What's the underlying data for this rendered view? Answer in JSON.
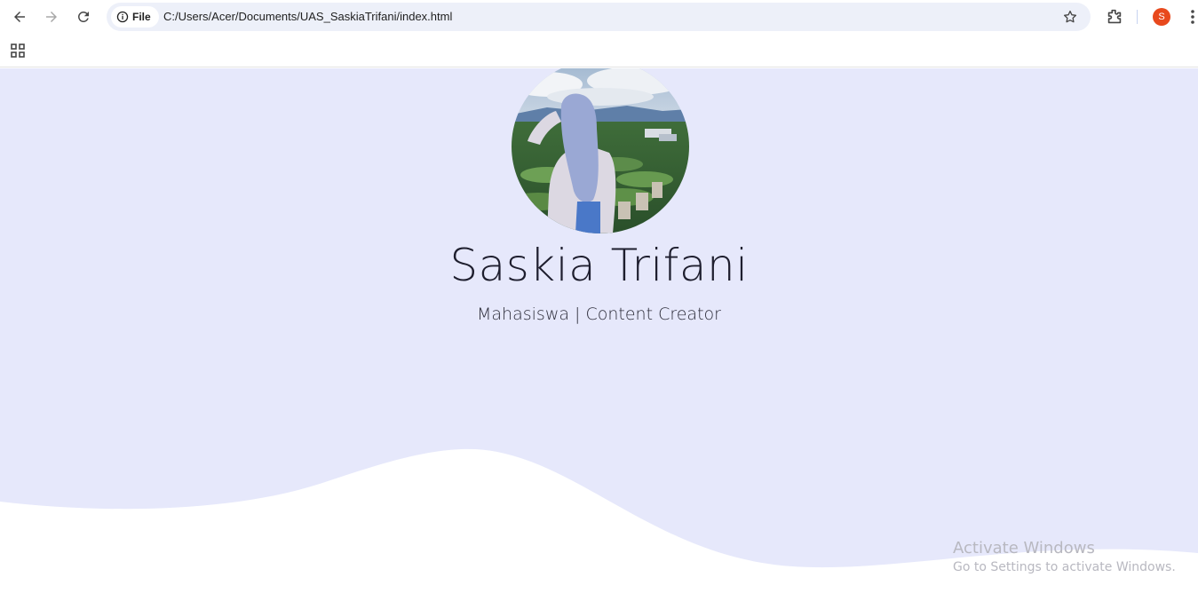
{
  "browser": {
    "chip_label": "File",
    "url": "C:/Users/Acer/Documents/UAS_SaskiaTrifani/index.html",
    "profile_initial": "S",
    "profile_color": "#e8491d"
  },
  "hero": {
    "name": "Saskia Trifani",
    "tagline": "Mahasiswa | Content Creator",
    "background_color": "#e6e8fb"
  },
  "os_watermark": {
    "title": "Activate Windows",
    "subtitle": "Go to Settings to activate Windows."
  },
  "icons": {
    "back": "arrow-left-icon",
    "forward": "arrow-right-icon",
    "reload": "reload-icon",
    "site_info": "info-icon",
    "bookmark": "star-icon",
    "extensions": "puzzle-icon",
    "menu": "kebab-menu-icon",
    "apps": "apps-grid-icon"
  }
}
